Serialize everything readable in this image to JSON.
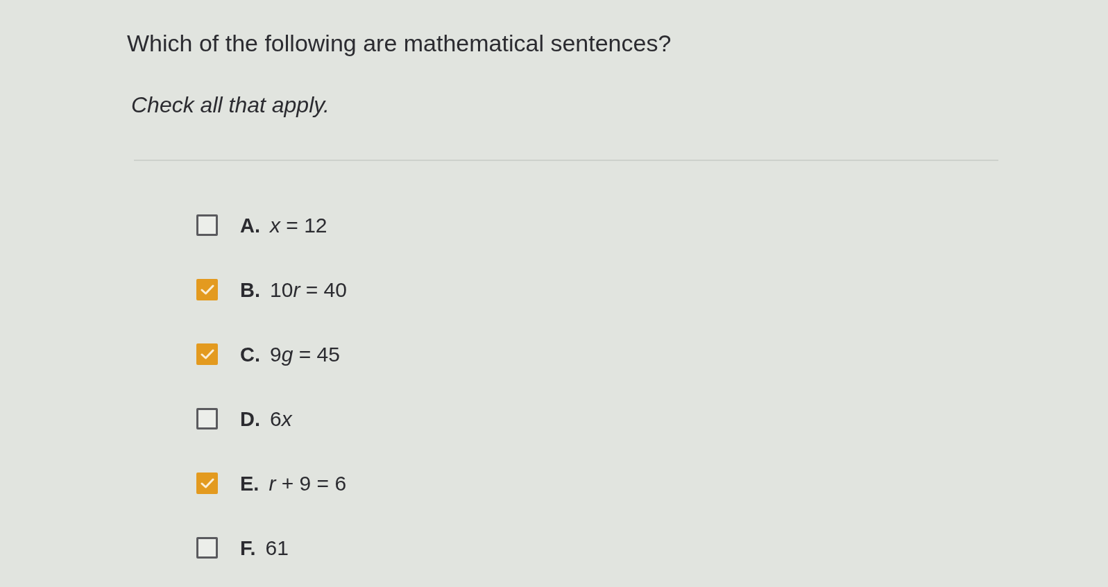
{
  "question": "Which of the following are mathematical sentences?",
  "instruction": "Check all that apply.",
  "options": [
    {
      "letter": "A.",
      "expression": [
        {
          "text": "x",
          "italic": true
        },
        {
          "text": " = 12",
          "italic": false
        }
      ],
      "checked": false
    },
    {
      "letter": "B.",
      "expression": [
        {
          "text": "10",
          "italic": false
        },
        {
          "text": "r",
          "italic": true
        },
        {
          "text": " = 40",
          "italic": false
        }
      ],
      "checked": true
    },
    {
      "letter": "C.",
      "expression": [
        {
          "text": "9",
          "italic": false
        },
        {
          "text": "g",
          "italic": true
        },
        {
          "text": " = 45",
          "italic": false
        }
      ],
      "checked": true
    },
    {
      "letter": "D.",
      "expression": [
        {
          "text": "6",
          "italic": false
        },
        {
          "text": "x",
          "italic": true
        }
      ],
      "checked": false
    },
    {
      "letter": "E.",
      "expression": [
        {
          "text": "r",
          "italic": true
        },
        {
          "text": " + 9 = 6",
          "italic": false
        }
      ],
      "checked": true
    },
    {
      "letter": "F.",
      "expression": [
        {
          "text": "61",
          "italic": false
        }
      ],
      "checked": false
    }
  ]
}
